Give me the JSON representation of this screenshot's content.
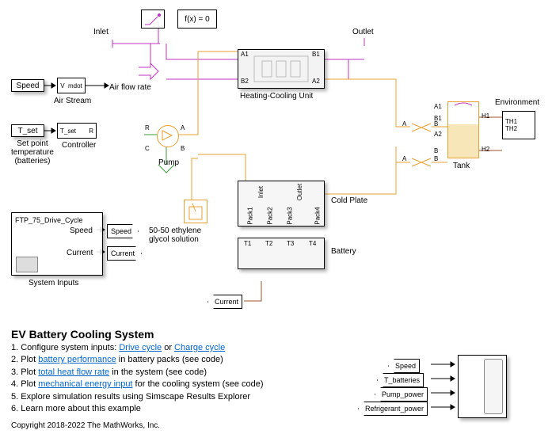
{
  "top": {
    "fx": "f(x) = 0",
    "inlet": "Inlet",
    "outlet": "Outlet",
    "airflow": "Air flow rate",
    "airstream": "Air Stream"
  },
  "inputs": {
    "speed_src": "Speed",
    "tset_src": "T_set",
    "tset_cap": "Set point\ntemperature\n(batteries)",
    "controller": "Controller",
    "pump": "Pump",
    "glycol": "50-50 ethylene\nglycol solution",
    "sysblock": "FTP_75_Drive_Cycle",
    "sys_speed": "Speed",
    "sys_current": "Current",
    "sys_cap": "System Inputs",
    "speed_tag": "Speed",
    "current_tag": "Current",
    "current_tag2": "Current"
  },
  "center": {
    "hcu": "Heating-Cooling Unit",
    "coldplate": "Cold Plate",
    "battery": "Battery",
    "pack1": "Pack1",
    "pack2": "Pack2",
    "pack3": "Pack3",
    "pack4": "Pack4",
    "inlet": "Inlet",
    "outlet": "Outlet",
    "t1": "T1",
    "t2": "T2",
    "t3": "T3",
    "t4": "T4",
    "a1": "A1",
    "b1": "B1",
    "a2": "A2",
    "b2": "B2"
  },
  "right": {
    "tank": "Tank",
    "env": "Environment",
    "th1": "TH1",
    "th2": "TH2",
    "h1": "H1",
    "h2": "H2",
    "a1": "A1",
    "b1": "B1",
    "a2": "A2",
    "b": "B",
    "a": "A"
  },
  "scope": {
    "s1": "Speed",
    "s2": "T_batteries",
    "s3": "Pump_power",
    "s4": "Refrigerant_power"
  },
  "footer": {
    "title": "EV Battery Cooling System",
    "l1": "1. Configure system inputs: ",
    "l1a": "Drive cycle",
    "l1b": " or ",
    "l1c": "Charge cycle",
    "l2": "2. Plot ",
    "l2a": "battery performance",
    "l2b": " in battery packs (see code)",
    "l3": "3. Plot ",
    "l3a": "total heat flow rate",
    "l3b": " in the system (see code)",
    "l4": "4. Plot ",
    "l4a": "mechanical energy input",
    "l4b": " for the cooling system (see code)",
    "l5": "5. Explore simulation results using Simscape Results Explorer",
    "l6": "6. Learn more about this example",
    "copy": "Copyright 2018-2022 The MathWorks, Inc."
  }
}
